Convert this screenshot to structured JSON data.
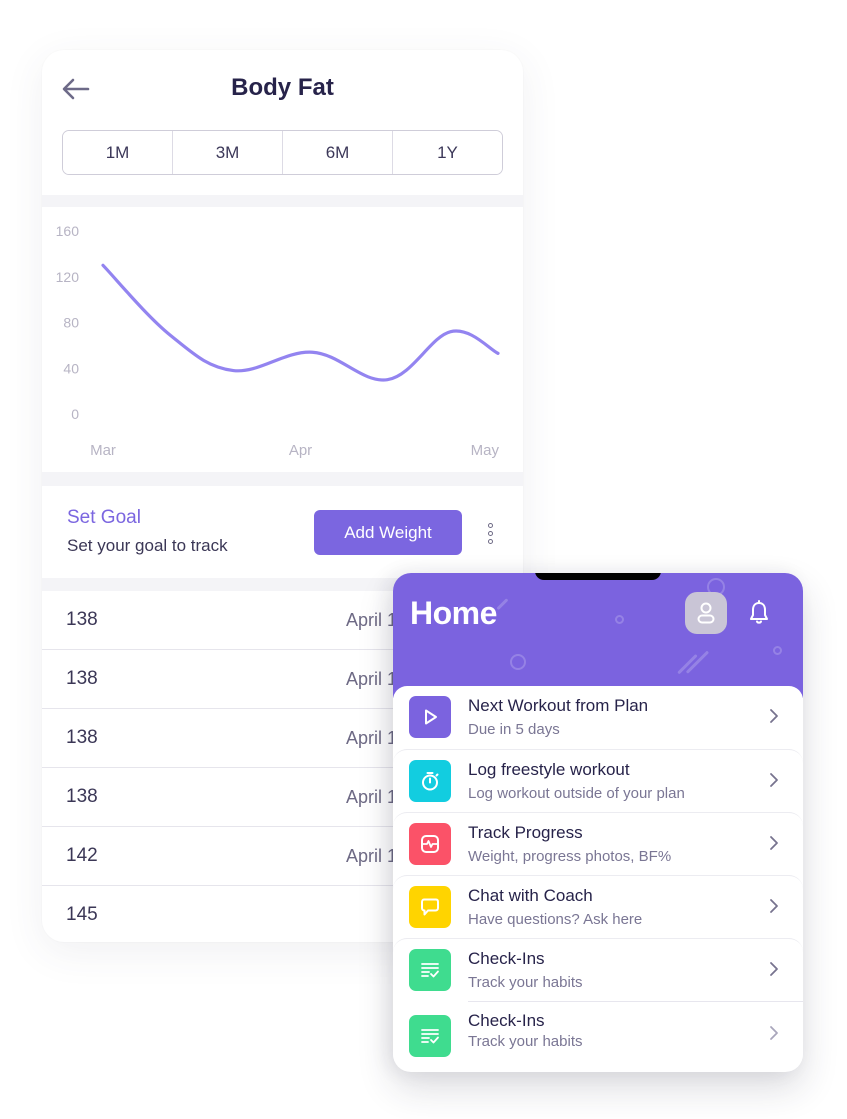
{
  "body_fat": {
    "title": "Body Fat",
    "back_icon": "arrow-left-icon",
    "ranges": [
      "1M",
      "3M",
      "6M",
      "1Y"
    ],
    "goal": {
      "title": "Set Goal",
      "subtitle": "Set your goal to track",
      "add_button": "Add Weight",
      "more_icon": "vertical-ellipsis-icon"
    },
    "entries": [
      {
        "value": "138",
        "date": "April 1"
      },
      {
        "value": "138",
        "date": "April 1"
      },
      {
        "value": "138",
        "date": "April 1"
      },
      {
        "value": "138",
        "date": "April 1"
      },
      {
        "value": "142",
        "date": "April 1"
      },
      {
        "value": "145",
        "date": ""
      }
    ]
  },
  "chart_data": {
    "type": "line",
    "title": "",
    "xlabel": "",
    "ylabel": "",
    "x_tick_labels": [
      "Mar",
      "Apr",
      "May"
    ],
    "y_ticks": [
      160,
      120,
      80,
      40,
      0
    ],
    "ylim": [
      0,
      160
    ],
    "grid": false,
    "smooth": true,
    "color": "#9384f0",
    "series": [
      {
        "name": "Body Fat",
        "x": [
          0,
          0.17,
          0.33,
          0.53,
          0.72,
          0.88,
          1.0
        ],
        "values": [
          130,
          69,
          38,
          54,
          30,
          72,
          53
        ]
      }
    ]
  },
  "home": {
    "title": "Home",
    "avatar_icon": "user-icon",
    "bell_icon": "bell-icon",
    "accent": "#7b63df",
    "items": [
      {
        "title": "Next Workout from Plan",
        "subtitle": "Due in 5 days",
        "icon": "play-icon",
        "color": "#7b63df"
      },
      {
        "title": "Log freestyle workout",
        "subtitle": "Log workout outside of your plan",
        "icon": "stopwatch-icon",
        "color": "#12cde0"
      },
      {
        "title": "Track Progress",
        "subtitle": "Weight, progress photos, BF%",
        "icon": "activity-monitor-icon",
        "color": "#fb5268"
      },
      {
        "title": "Chat with Coach",
        "subtitle": "Have questions? Ask here",
        "icon": "chat-bubble-icon",
        "color": "#ffd400"
      },
      {
        "title": "Check-Ins",
        "subtitle": "Track your habits",
        "icon": "checklist-icon",
        "color": "#3fdc8f"
      },
      {
        "title": "Check-Ins",
        "subtitle": "Track your habits",
        "icon": "checklist-icon",
        "color": "#3fdc8f"
      }
    ]
  }
}
